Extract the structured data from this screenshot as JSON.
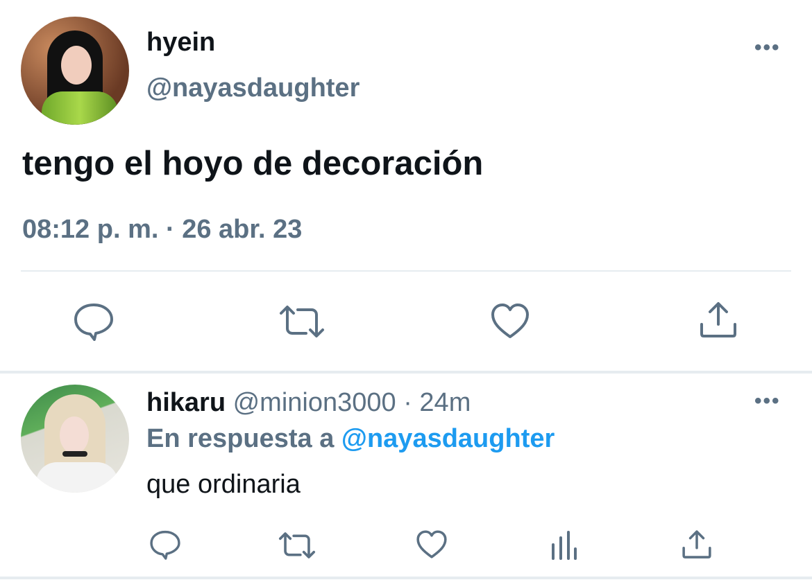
{
  "tweet": {
    "display_name": "hyein",
    "handle": "@nayasdaughter",
    "text": "tengo el hoyo de decoración",
    "timestamp": "08:12 p. m. · 26 abr. 23",
    "more": "•••"
  },
  "reply": {
    "display_name": "hikaru",
    "meta": " @minion3000 · 24m",
    "in_reply_prefix": "En respuesta a ",
    "in_reply_mention": "@nayasdaughter",
    "text": "que ordinaria",
    "more": "•••"
  },
  "icons": {
    "reply": "speech-bubble-icon",
    "retweet": "retweet-icon",
    "like": "heart-icon",
    "share": "share-icon",
    "analytics": "bar-chart-icon"
  },
  "colors": {
    "secondary_text": "#5b7083",
    "link": "#1d9bf0",
    "divider": "#e6ecf0"
  }
}
